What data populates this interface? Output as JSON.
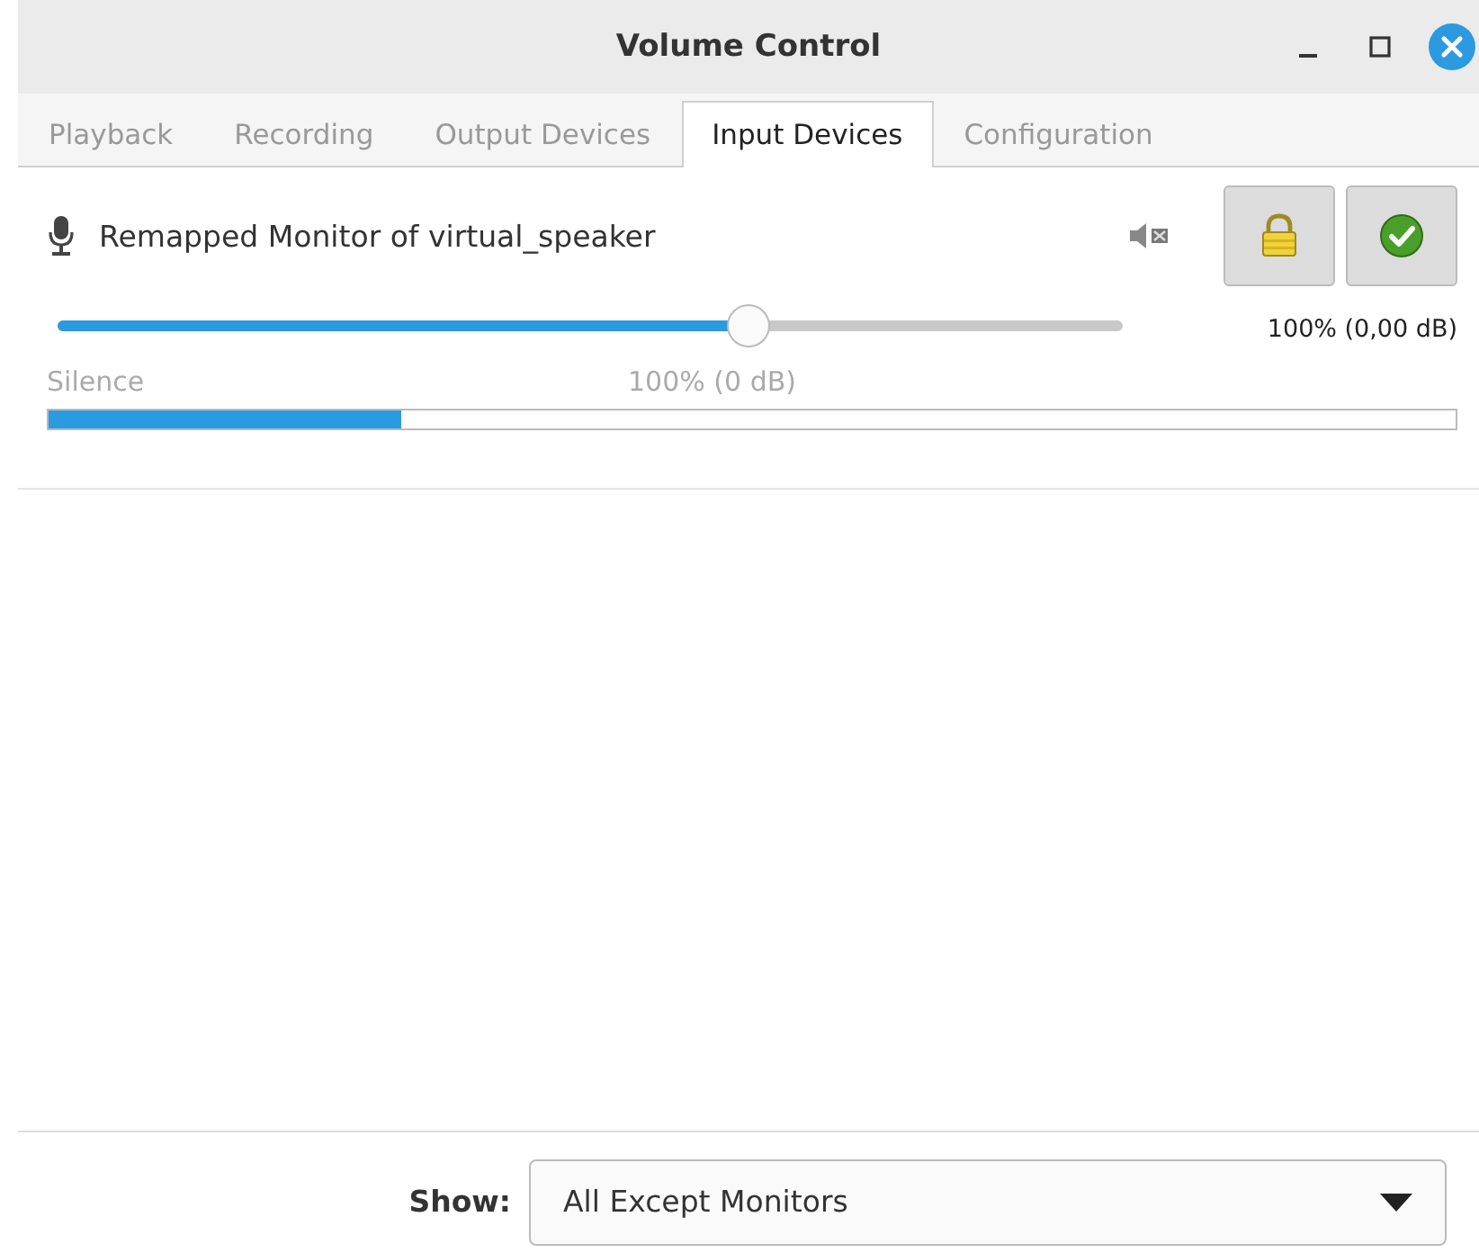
{
  "window": {
    "title": "Volume Control"
  },
  "tabs": [
    {
      "label": "Playback",
      "selected": false
    },
    {
      "label": "Recording",
      "selected": false
    },
    {
      "label": "Output Devices",
      "selected": false
    },
    {
      "label": "Input Devices",
      "selected": true
    },
    {
      "label": "Configuration",
      "selected": false
    }
  ],
  "devices": [
    {
      "name": "Remapped Monitor of virtual_speaker",
      "level": 0.648,
      "reading": "100% (0,00 dB)",
      "mark_start": "Silence",
      "mark_mid": "100% (0 dB)",
      "peak": {
        "level": 0.25
      }
    }
  ],
  "show": {
    "label": "Show:",
    "value": "All Except Monitors"
  }
}
